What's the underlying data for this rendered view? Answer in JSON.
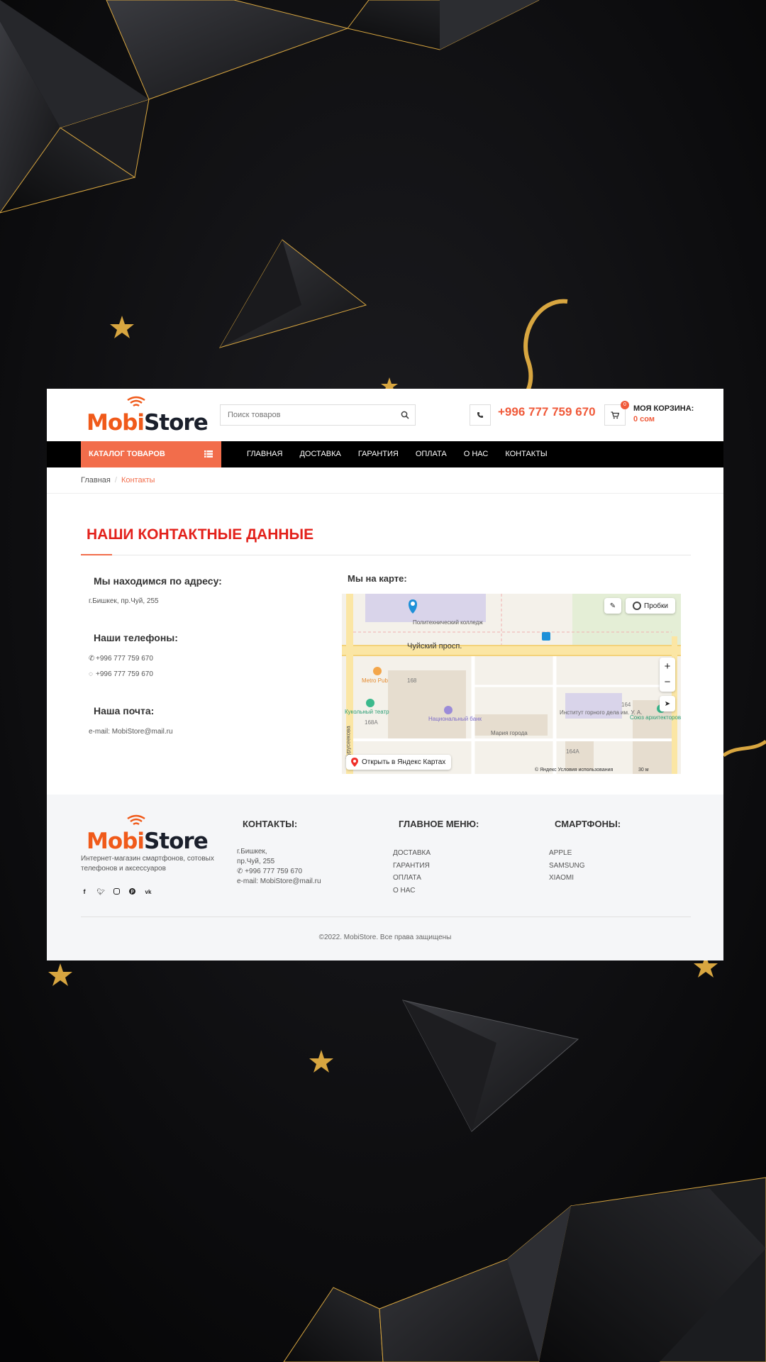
{
  "colors": {
    "accent": "#f26d4b",
    "title_red": "#e3211b",
    "brand_orange": "#f05a1a",
    "brand_dark": "#1a1f2b",
    "nav_bg": "#000000",
    "gold": "#d8a640"
  },
  "logo": {
    "part1": "Mobi",
    "part2": "Store"
  },
  "header": {
    "search_placeholder": "Поиск товаров",
    "phone": "+996 777 759 670",
    "cart_count": "0",
    "cart_title": "МОЯ КОРЗИНА:",
    "cart_sum": "0 сом"
  },
  "nav": {
    "catalog": "КАТАЛОГ ТОВАРОВ",
    "items": [
      "ГЛАВНАЯ",
      "ДОСТАВКА",
      "ГАРАНТИЯ",
      "ОПЛАТА",
      "О НАС",
      "КОНТАКТЫ"
    ]
  },
  "breadcrumb": {
    "home": "Главная",
    "separator": "/",
    "current": "Контакты"
  },
  "contacts": {
    "title": "НАШИ КОНТАКТНЫЕ ДАННЫЕ",
    "address_heading": "Мы находимся по адресу:",
    "address": "г.Бишкек, пр.Чуй, 255",
    "phones_heading": "Наши телефоны:",
    "phone1": "+996 777 759 670",
    "phone2": "+996 777 759 670",
    "mail_heading": "Наша почта:",
    "email": "e-mail: MobiStore@mail.ru",
    "map_heading": "Мы на карте:"
  },
  "map": {
    "traffic": "Пробки",
    "open_link": "Открыть в Яндекс Картах",
    "copyright": "© Яндекс   Условия использования",
    "scale": "30 м",
    "labels": {
      "college": "Политехнический колледж",
      "avenue": "Чуйский просп.",
      "metro": "Metro Pub",
      "theatre": "Кукольный театр",
      "bank": "Национальный банк",
      "mall": "Мария города",
      "institute": "Институт горного дела им. У. А.",
      "union": "Союз архитекторов",
      "street": "Курусеекова",
      "n168": "168",
      "n168a": "168А",
      "n164": "164",
      "n164a": "164А"
    }
  },
  "footer": {
    "description": "Интернет-магазин смартфонов, сотовых телефонов и аксессуаров",
    "socials": [
      "facebook-icon",
      "twitter-icon",
      "instagram-icon",
      "pinterest-icon",
      "vk-icon"
    ],
    "contacts_heading": "КОНТАКТЫ:",
    "contacts_lines": [
      "г.Бишкек,",
      "пр.Чуй, 255",
      "+996 777 759 670",
      "e-mail: MobiStore@mail.ru"
    ],
    "menu_heading": "ГЛАВНОЕ МЕНЮ:",
    "menu_items": [
      "ДОСТАВКА",
      "ГАРАНТИЯ",
      "ОПЛАТА",
      "О НАС"
    ],
    "phones_heading": "СМАРТФОНЫ:",
    "phones_items": [
      "APPLE",
      "SAMSUNG",
      "XIAOMI"
    ],
    "copyright": "©2022. MobiStore. Все права защищены"
  }
}
